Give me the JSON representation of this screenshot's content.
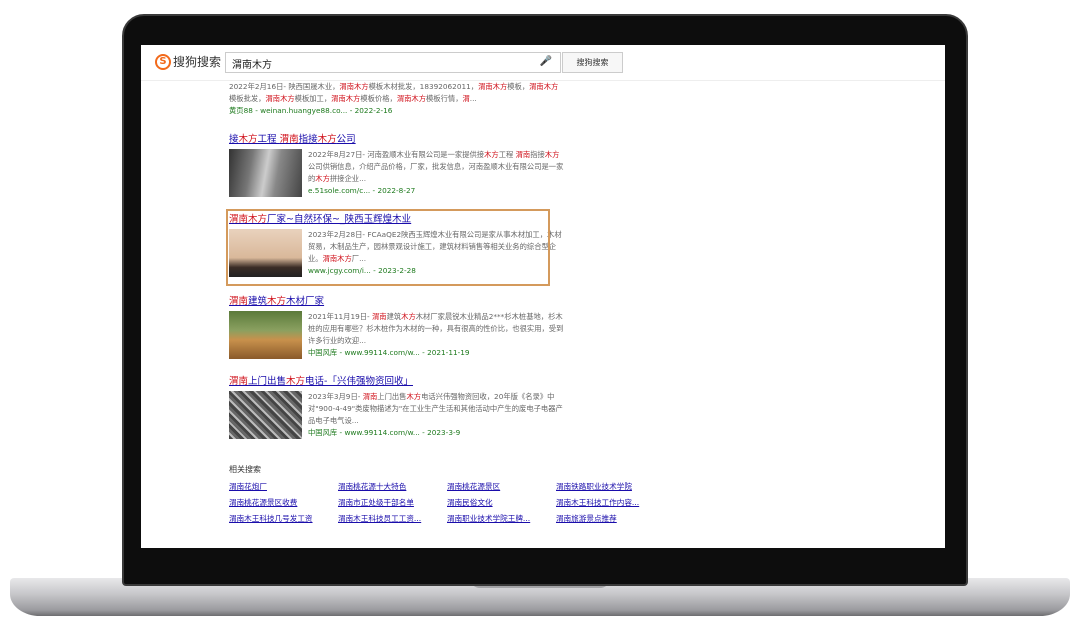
{
  "header": {
    "logo_text": "搜狗搜索",
    "query": "渭南木方",
    "search_button": "搜狗搜索"
  },
  "results": [
    {
      "title": [],
      "snippet": [
        {
          "t": "2022年2月16日- 陕西国晟木业，",
          "h": false
        },
        {
          "t": "渭南木方",
          "h": true
        },
        {
          "t": "模板木材批发，18392062011，",
          "h": false
        },
        {
          "t": "渭南木方",
          "h": true
        },
        {
          "t": "模板，",
          "h": false
        },
        {
          "t": "渭南木方",
          "h": true
        },
        {
          "t": "模板批发，",
          "h": false
        },
        {
          "t": "渭南木方",
          "h": true
        },
        {
          "t": "模板加工，",
          "h": false
        },
        {
          "t": "渭南木方",
          "h": true
        },
        {
          "t": "模板价格，",
          "h": false
        },
        {
          "t": "渭南木方",
          "h": true
        },
        {
          "t": "模板行情，",
          "h": false
        },
        {
          "t": "渭",
          "h": true
        },
        {
          "t": "...",
          "h": false
        }
      ],
      "url": "黄页88 - weinan.huangye88.co... - 2022-2-16",
      "thumb": ""
    },
    {
      "title": [
        {
          "t": "接",
          "h": false
        },
        {
          "t": "木方",
          "h": true
        },
        {
          "t": "工程 ",
          "h": false
        },
        {
          "t": "渭南",
          "h": true
        },
        {
          "t": "指接",
          "h": false
        },
        {
          "t": "木方",
          "h": true
        },
        {
          "t": "公司",
          "h": false
        }
      ],
      "snippet": [
        {
          "t": "2022年8月27日- 河南盈顺木业有限公司是一家提供接",
          "h": false
        },
        {
          "t": "木方",
          "h": true
        },
        {
          "t": "工程 ",
          "h": false
        },
        {
          "t": "渭南",
          "h": true
        },
        {
          "t": "指接",
          "h": false
        },
        {
          "t": "木方",
          "h": true
        },
        {
          "t": "公司供销信息，介绍产品价格，厂家，批发信息，河南盈顺木业有限公司是一家的",
          "h": false
        },
        {
          "t": "木方",
          "h": true
        },
        {
          "t": "拼接企业...",
          "h": false
        }
      ],
      "url": "e.51sole.com/c... - 2022-8-27",
      "thumb": "steel"
    },
    {
      "title": [
        {
          "t": "渭南木方",
          "h": true
        },
        {
          "t": "厂家~自然环保~_陕西玉辉煌木业",
          "h": false
        }
      ],
      "snippet": [
        {
          "t": "2023年2月28日- FCAaQE2陕西玉辉煌木业有限公司是家从事木材加工，木材贸易，木制品生产，园林景观设计施工，建筑材料销售等相关业务的综合型企业。",
          "h": false
        },
        {
          "t": "渭南木方",
          "h": true
        },
        {
          "t": "厂...",
          "h": false
        }
      ],
      "url": "www.jcgy.com/i... - 2023-2-28",
      "thumb": "wood"
    },
    {
      "title": [
        {
          "t": "渭南",
          "h": true
        },
        {
          "t": "建筑",
          "h": false
        },
        {
          "t": "木方",
          "h": true
        },
        {
          "t": "木材厂家",
          "h": false
        }
      ],
      "snippet": [
        {
          "t": "2021年11月19日- ",
          "h": false
        },
        {
          "t": "渭南",
          "h": true
        },
        {
          "t": "建筑",
          "h": false
        },
        {
          "t": "木方",
          "h": true
        },
        {
          "t": "木材厂家晨锐木业精品2***杉木桩基地，杉木桩的应用有哪些？杉木桩作为木材的一种，具有很高的性价比，也很实用，受到许多行业的欢迎...",
          "h": false
        }
      ],
      "url": "中国风库 - www.99114.com/w... - 2021-11-19",
      "thumb": "logs"
    },
    {
      "title": [
        {
          "t": "渭南",
          "h": true
        },
        {
          "t": "上门出售",
          "h": false
        },
        {
          "t": "木方",
          "h": true
        },
        {
          "t": "电话-「兴伟强物资回收」",
          "h": false
        }
      ],
      "snippet": [
        {
          "t": "2023年3月9日- ",
          "h": false
        },
        {
          "t": "渭南",
          "h": true
        },
        {
          "t": "上门出售",
          "h": false
        },
        {
          "t": "木方",
          "h": true
        },
        {
          "t": "电话兴伟强物资回收，20年版《名录》中对\"900-4-49\"类废物描述为\"在工业生产生活和其他活动中产生的废电子电器产品电子电气设...",
          "h": false
        }
      ],
      "url": "中国风库 - www.99114.com/w... - 2023-3-9",
      "thumb": "scrap"
    }
  ],
  "related": {
    "heading": "相关搜索",
    "items": [
      "渭南花炮厂",
      "渭南桃花源十大特色",
      "渭南桃花源景区",
      "渭南铁路职业技术学院",
      "渭南桃花源景区收费",
      "渭南市正处级干部名单",
      "渭南民俗文化",
      "渭南木王科技工作内容...",
      "渭南木王科技几号发工资",
      "渭南木王科技员工工资...",
      "渭南职业技术学院王牌...",
      "渭南旅游景点推荐"
    ]
  },
  "colors": {
    "highlight": "#d0111b",
    "link": "#1a0dab",
    "url": "#1e7a1e",
    "selection_box": "#d49a5c",
    "brand": "#f26a1b"
  }
}
